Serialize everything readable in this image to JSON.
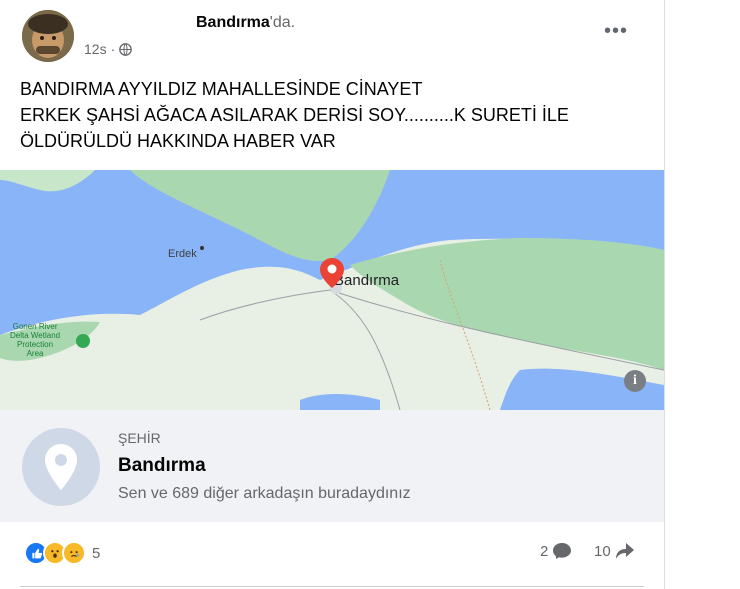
{
  "post": {
    "author_name": "Bandırma",
    "location_suffix": "'da.",
    "time": "12s",
    "dot": "·",
    "more_label": "•••",
    "text": "BANDIRMA AYYILDIZ MAHALLESİNDE CİNAYET\nERKEK ŞAHSİ AĞACA ASILARAK DERİSİ SOY..........K SURETİ İLE\nÖLDÜRÜLDÜ HAKKINDA HABER VAR"
  },
  "map": {
    "label_erdek": "Erdek",
    "label_bandirma": "Bandırma",
    "label_wetland": "Gonen River\nDelta Wetland\nProtection\nArea",
    "info_icon": "i",
    "colors": {
      "water": "#8ab4f8",
      "land": "#e8efe4",
      "green": "#a9d8b0",
      "pin": "#ea4335"
    }
  },
  "place": {
    "category": "ŞEHİR",
    "name": "Bandırma",
    "description": "Sen ve 689 diğer arkadaşın buradaydınız"
  },
  "footer": {
    "reactions_count": "5",
    "comments_count": "2",
    "shares_count": "10"
  }
}
